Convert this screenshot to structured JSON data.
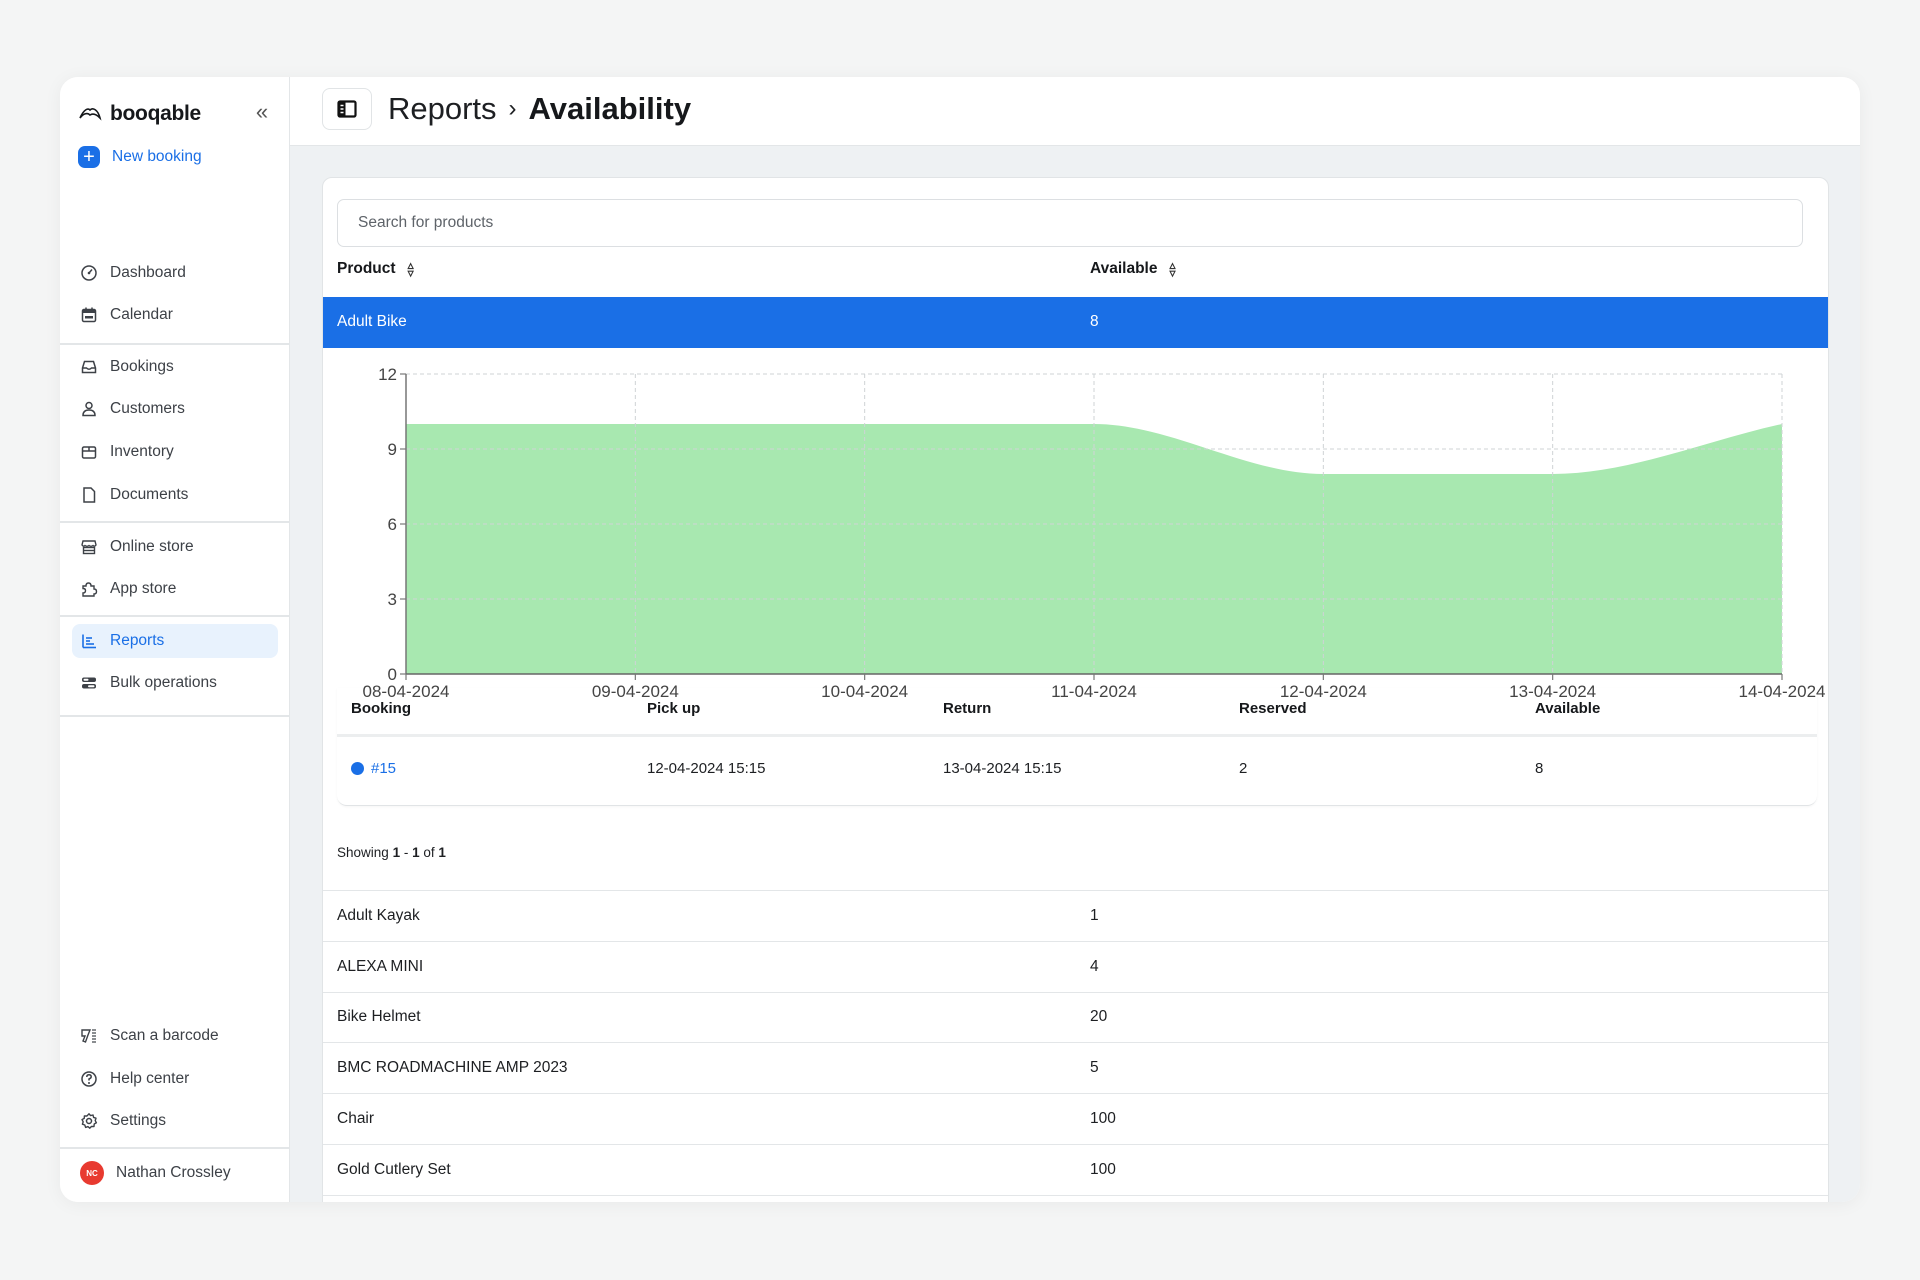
{
  "app": {
    "brand": "booqable"
  },
  "sidebar": {
    "new_booking": "New booking",
    "groups": [
      [
        {
          "label": "Dashboard",
          "icon": "dashboard-icon"
        },
        {
          "label": "Calendar",
          "icon": "calendar-icon"
        }
      ],
      [
        {
          "label": "Bookings",
          "icon": "inbox-icon"
        },
        {
          "label": "Customers",
          "icon": "user-icon"
        },
        {
          "label": "Inventory",
          "icon": "box-icon"
        },
        {
          "label": "Documents",
          "icon": "document-icon"
        }
      ],
      [
        {
          "label": "Online store",
          "icon": "store-icon"
        },
        {
          "label": "App store",
          "icon": "puzzle-icon"
        }
      ],
      [
        {
          "label": "Reports",
          "icon": "reports-icon",
          "active": true
        },
        {
          "label": "Bulk operations",
          "icon": "bulk-icon"
        }
      ]
    ],
    "bottom": [
      {
        "label": "Scan a barcode",
        "icon": "barcode-scanner-icon"
      },
      {
        "label": "Help center",
        "icon": "help-icon"
      },
      {
        "label": "Settings",
        "icon": "gear-icon"
      }
    ],
    "user": {
      "name": "Nathan Crossley",
      "initials": "NC",
      "color": "#e83a30"
    }
  },
  "header": {
    "parent": "Reports",
    "separator": "›",
    "current": "Availability"
  },
  "search": {
    "placeholder": "Search for products",
    "value": ""
  },
  "table": {
    "columns": [
      "Product",
      "Available"
    ],
    "selected": {
      "product": "Adult Bike",
      "available": "8"
    },
    "rows": [
      {
        "product": "Adult Kayak",
        "available": "1"
      },
      {
        "product": "ALEXA MINI",
        "available": "4"
      },
      {
        "product": "Bike Helmet",
        "available": "20"
      },
      {
        "product": "BMC ROADMACHINE AMP 2023",
        "available": "5"
      },
      {
        "product": "Chair",
        "available": "100"
      },
      {
        "product": "Gold Cutlery Set",
        "available": "100"
      }
    ]
  },
  "chart_data": {
    "type": "area",
    "title": "",
    "xlabel": "",
    "ylabel": "",
    "categories": [
      "08-04-2024",
      "09-04-2024",
      "10-04-2024",
      "11-04-2024",
      "12-04-2024",
      "13-04-2024",
      "14-04-2024"
    ],
    "series": [
      {
        "name": "Available",
        "values": [
          10,
          10,
          10,
          10,
          8,
          8,
          10
        ],
        "color": "#a8e8b0"
      }
    ],
    "ylim": [
      0,
      12
    ],
    "yticks": [
      0,
      3,
      6,
      9,
      12
    ],
    "grid": true
  },
  "bookings": {
    "columns": [
      "Booking",
      "Pick up",
      "Return",
      "Reserved",
      "Available"
    ],
    "rows": [
      {
        "booking": "#15",
        "pickup": "12-04-2024 15:15",
        "return": "13-04-2024 15:15",
        "reserved": "2",
        "available": "8"
      }
    ],
    "showing": {
      "prefix": "Showing",
      "from": "1",
      "dash": "-",
      "to": "1",
      "of": "of",
      "total": "1"
    }
  },
  "colors": {
    "accent": "#1a6fe6",
    "area": "#a8e8b0"
  }
}
